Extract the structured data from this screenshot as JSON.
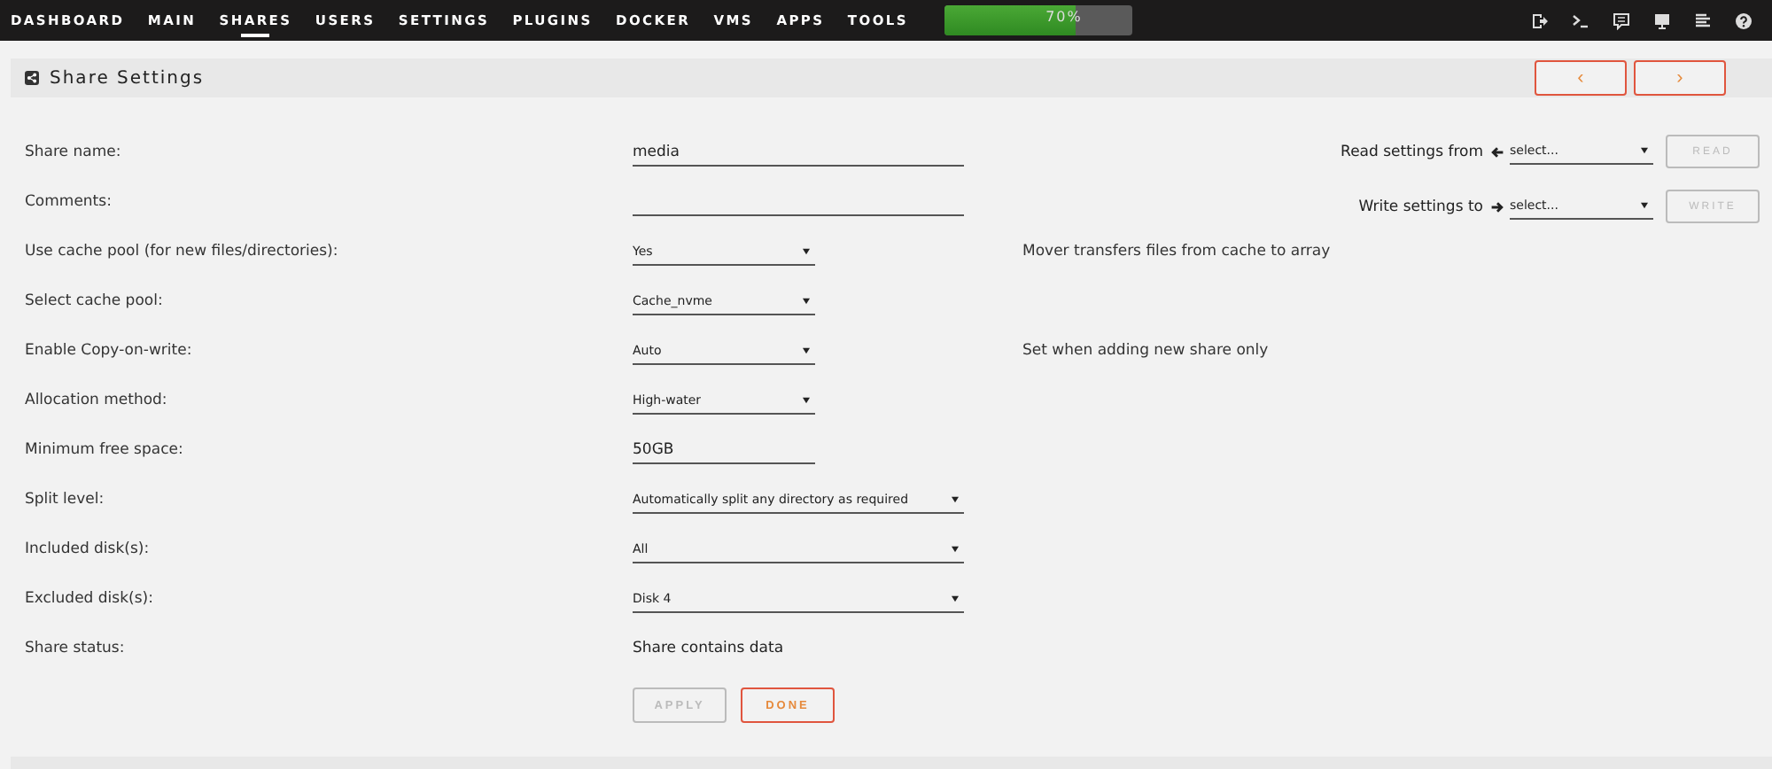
{
  "nav": [
    {
      "label": "DASHBOARD",
      "selected": false
    },
    {
      "label": "MAIN",
      "selected": false
    },
    {
      "label": "SHARES",
      "selected": true
    },
    {
      "label": "USERS",
      "selected": false
    },
    {
      "label": "SETTINGS",
      "selected": false
    },
    {
      "label": "PLUGINS",
      "selected": false
    },
    {
      "label": "DOCKER",
      "selected": false
    },
    {
      "label": "VMS",
      "selected": false
    },
    {
      "label": "APPS",
      "selected": false
    },
    {
      "label": "TOOLS",
      "selected": false
    }
  ],
  "usage": {
    "level": 0.7,
    "reading": "70%"
  },
  "panel": {
    "title": "Share Settings",
    "prev": "‹",
    "next": "›"
  },
  "fields": [
    {
      "kind": "input",
      "label": "Share name:",
      "value": "media"
    },
    {
      "kind": "input",
      "label": "Comments:"
    },
    {
      "kind": "short-select",
      "label": "Use cache pool (for new files/directories):",
      "value": "Yes",
      "note": "Mover transfers files from cache to array"
    },
    {
      "kind": "short-select",
      "label": "Select cache pool:",
      "value": "Cache_nvme"
    },
    {
      "kind": "short-select",
      "label": "Enable Copy-on-write:",
      "value": "Auto",
      "note": "Set when adding new share only"
    },
    {
      "kind": "short-select",
      "label": "Allocation method:",
      "value": "High-water"
    },
    {
      "kind": "short-input",
      "label": "Minimum free space:",
      "value": "50GB"
    },
    {
      "kind": "select",
      "label": "Split level:",
      "value": "Automatically split any directory as required"
    },
    {
      "kind": "select",
      "label": "Included disk(s):",
      "value": "All"
    },
    {
      "kind": "select",
      "label": "Excluded disk(s):",
      "value": "Disk 4"
    },
    {
      "kind": "status",
      "label": "Share status:",
      "value": "Share contains data"
    }
  ],
  "sync": [
    {
      "kind": "read",
      "label": "Read settings from",
      "value": "select...",
      "button": "READ",
      "disabled": true
    },
    {
      "kind": "write",
      "label": "Write settings to",
      "value": "select...",
      "button": "WRITE",
      "disabled": true
    }
  ],
  "actions": [
    {
      "label": "APPLY",
      "disabled": true
    },
    {
      "label": "DONE",
      "disabled": false
    }
  ]
}
